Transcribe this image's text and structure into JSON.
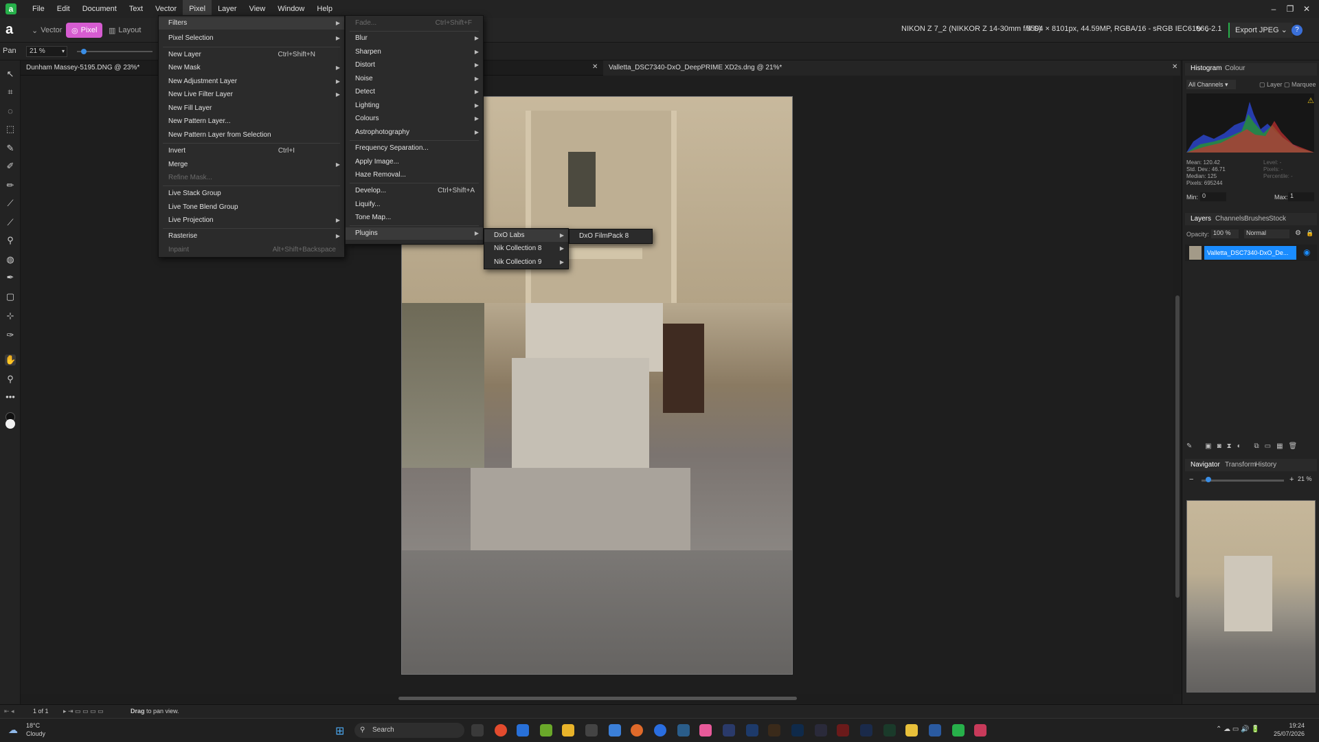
{
  "menubar": {
    "items": [
      "File",
      "Edit",
      "Document",
      "Text",
      "Vector",
      "Pixel",
      "Layer",
      "View",
      "Window",
      "Help"
    ],
    "active": "Pixel"
  },
  "toolbar": {
    "personas": [
      "Vector",
      "Pixel",
      "Layout"
    ],
    "active_persona": "Pixel",
    "camera_info": "NIKON Z 7_2 (NIKKOR Z 14-30mm f/4 S)",
    "image_info": "5504 × 8101px, 44.59MP, RGBA/16 - sRGB IEC61966-2.1",
    "export_label": "Export JPEG"
  },
  "context": {
    "tool_name": "Pan",
    "zoom_value": "21 %"
  },
  "tabs": [
    {
      "title": "Dunham Massey-5195.DNG @ 23%*"
    },
    {
      "title": "Valletta_DSC7340-DxO_DeepPRIME XD2s.dng @ 21%*"
    }
  ],
  "pixel_menu": [
    {
      "label": "Filters",
      "shortcut": "",
      "arrow": true,
      "selected": true
    },
    {
      "label": "Pixel Selection",
      "shortcut": "",
      "arrow": true
    },
    {
      "label": "New Layer",
      "shortcut": "Ctrl+Shift+N"
    },
    {
      "label": "New Mask",
      "arrow": true
    },
    {
      "label": "New Adjustment Layer",
      "arrow": true
    },
    {
      "label": "New Live Filter Layer",
      "arrow": true
    },
    {
      "label": "New Fill Layer"
    },
    {
      "label": "New Pattern Layer..."
    },
    {
      "label": "New Pattern Layer from Selection"
    },
    {
      "label": "Invert",
      "shortcut": "Ctrl+I"
    },
    {
      "label": "Merge",
      "arrow": true
    },
    {
      "label": "Refine Mask...",
      "disabled": true
    },
    {
      "label": "Live Stack Group"
    },
    {
      "label": "Live Tone Blend Group"
    },
    {
      "label": "Live Projection",
      "arrow": true
    },
    {
      "label": "Rasterise",
      "arrow": true
    },
    {
      "label": "Inpaint",
      "shortcut": "Alt+Shift+Backspace",
      "disabled": true
    }
  ],
  "filters_menu": [
    {
      "label": "Fade...",
      "shortcut": "Ctrl+Shift+F",
      "disabled": true
    },
    {
      "label": "Blur",
      "arrow": true
    },
    {
      "label": "Sharpen",
      "arrow": true
    },
    {
      "label": "Distort",
      "arrow": true
    },
    {
      "label": "Noise",
      "arrow": true
    },
    {
      "label": "Detect",
      "arrow": true
    },
    {
      "label": "Lighting",
      "arrow": true
    },
    {
      "label": "Colours",
      "arrow": true
    },
    {
      "label": "Astrophotography",
      "arrow": true
    },
    {
      "label": "Frequency Separation..."
    },
    {
      "label": "Apply Image..."
    },
    {
      "label": "Haze Removal..."
    },
    {
      "label": "Develop...",
      "shortcut": "Ctrl+Shift+A"
    },
    {
      "label": "Liquify..."
    },
    {
      "label": "Tone Map..."
    },
    {
      "label": "Plugins",
      "arrow": true,
      "selected": true
    }
  ],
  "plugins_menu": [
    {
      "label": "DxO Labs",
      "arrow": true,
      "selected": true
    },
    {
      "label": "Nik Collection 8",
      "arrow": true
    },
    {
      "label": "Nik Collection 9",
      "arrow": true
    }
  ],
  "dxo_menu": [
    {
      "label": "DxO FilmPack 8"
    }
  ],
  "histogram": {
    "tabs": [
      "Histogram",
      "Colour"
    ],
    "channel": "All Channels",
    "checks": [
      "Layer",
      "Marquee"
    ],
    "stats_left": [
      "Mean: 120.42",
      "Std. Dev.: 46.71",
      "Median: 125",
      "Pixels: 695244"
    ],
    "stats_right": [
      "Level: -",
      "Pixels: -",
      "Percentile: -"
    ],
    "min_label": "Min:",
    "min_value": "0",
    "max_label": "Max:",
    "max_value": "1"
  },
  "layers": {
    "tabs": [
      "Layers",
      "Channels",
      "Brushes",
      "Stock"
    ],
    "opacity_label": "Opacity:",
    "opacity": "100 %",
    "blend": "Normal",
    "layer_name": "Valletta_DSC7340-DxO_De..."
  },
  "navigator": {
    "tabs": [
      "Navigator",
      "Transform",
      "History"
    ],
    "zoom": "21 %"
  },
  "status": {
    "page": "1 of 1",
    "hint_bold": "Drag",
    "hint_rest": "to pan view."
  },
  "taskbar": {
    "weather_temp": "18°C",
    "weather_text": "Cloudy",
    "search_placeholder": "Search",
    "time": "19:24",
    "date": "25/07/2026"
  }
}
